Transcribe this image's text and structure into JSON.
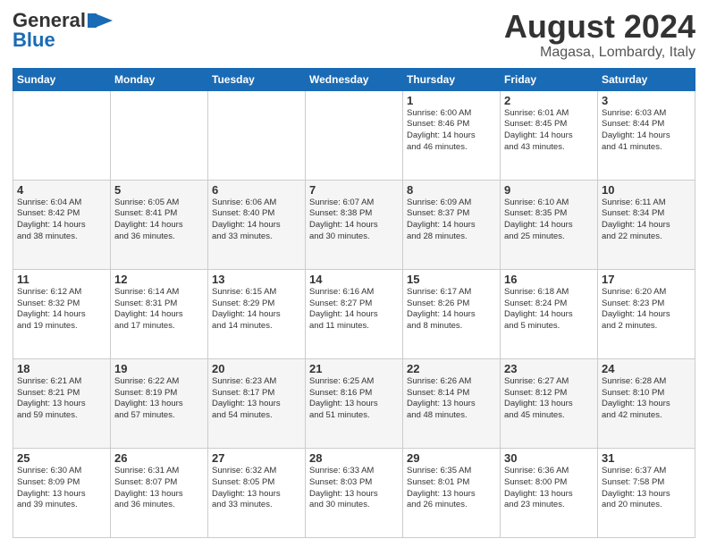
{
  "logo": {
    "line1": "General",
    "line2": "Blue",
    "icon": "▶"
  },
  "header": {
    "month": "August 2024",
    "location": "Magasa, Lombardy, Italy"
  },
  "days_of_week": [
    "Sunday",
    "Monday",
    "Tuesday",
    "Wednesday",
    "Thursday",
    "Friday",
    "Saturday"
  ],
  "weeks": [
    [
      {
        "day": "",
        "text": ""
      },
      {
        "day": "",
        "text": ""
      },
      {
        "day": "",
        "text": ""
      },
      {
        "day": "",
        "text": ""
      },
      {
        "day": "1",
        "text": "Sunrise: 6:00 AM\nSunset: 8:46 PM\nDaylight: 14 hours\nand 46 minutes."
      },
      {
        "day": "2",
        "text": "Sunrise: 6:01 AM\nSunset: 8:45 PM\nDaylight: 14 hours\nand 43 minutes."
      },
      {
        "day": "3",
        "text": "Sunrise: 6:03 AM\nSunset: 8:44 PM\nDaylight: 14 hours\nand 41 minutes."
      }
    ],
    [
      {
        "day": "4",
        "text": "Sunrise: 6:04 AM\nSunset: 8:42 PM\nDaylight: 14 hours\nand 38 minutes."
      },
      {
        "day": "5",
        "text": "Sunrise: 6:05 AM\nSunset: 8:41 PM\nDaylight: 14 hours\nand 36 minutes."
      },
      {
        "day": "6",
        "text": "Sunrise: 6:06 AM\nSunset: 8:40 PM\nDaylight: 14 hours\nand 33 minutes."
      },
      {
        "day": "7",
        "text": "Sunrise: 6:07 AM\nSunset: 8:38 PM\nDaylight: 14 hours\nand 30 minutes."
      },
      {
        "day": "8",
        "text": "Sunrise: 6:09 AM\nSunset: 8:37 PM\nDaylight: 14 hours\nand 28 minutes."
      },
      {
        "day": "9",
        "text": "Sunrise: 6:10 AM\nSunset: 8:35 PM\nDaylight: 14 hours\nand 25 minutes."
      },
      {
        "day": "10",
        "text": "Sunrise: 6:11 AM\nSunset: 8:34 PM\nDaylight: 14 hours\nand 22 minutes."
      }
    ],
    [
      {
        "day": "11",
        "text": "Sunrise: 6:12 AM\nSunset: 8:32 PM\nDaylight: 14 hours\nand 19 minutes."
      },
      {
        "day": "12",
        "text": "Sunrise: 6:14 AM\nSunset: 8:31 PM\nDaylight: 14 hours\nand 17 minutes."
      },
      {
        "day": "13",
        "text": "Sunrise: 6:15 AM\nSunset: 8:29 PM\nDaylight: 14 hours\nand 14 minutes."
      },
      {
        "day": "14",
        "text": "Sunrise: 6:16 AM\nSunset: 8:27 PM\nDaylight: 14 hours\nand 11 minutes."
      },
      {
        "day": "15",
        "text": "Sunrise: 6:17 AM\nSunset: 8:26 PM\nDaylight: 14 hours\nand 8 minutes."
      },
      {
        "day": "16",
        "text": "Sunrise: 6:18 AM\nSunset: 8:24 PM\nDaylight: 14 hours\nand 5 minutes."
      },
      {
        "day": "17",
        "text": "Sunrise: 6:20 AM\nSunset: 8:23 PM\nDaylight: 14 hours\nand 2 minutes."
      }
    ],
    [
      {
        "day": "18",
        "text": "Sunrise: 6:21 AM\nSunset: 8:21 PM\nDaylight: 13 hours\nand 59 minutes."
      },
      {
        "day": "19",
        "text": "Sunrise: 6:22 AM\nSunset: 8:19 PM\nDaylight: 13 hours\nand 57 minutes."
      },
      {
        "day": "20",
        "text": "Sunrise: 6:23 AM\nSunset: 8:17 PM\nDaylight: 13 hours\nand 54 minutes."
      },
      {
        "day": "21",
        "text": "Sunrise: 6:25 AM\nSunset: 8:16 PM\nDaylight: 13 hours\nand 51 minutes."
      },
      {
        "day": "22",
        "text": "Sunrise: 6:26 AM\nSunset: 8:14 PM\nDaylight: 13 hours\nand 48 minutes."
      },
      {
        "day": "23",
        "text": "Sunrise: 6:27 AM\nSunset: 8:12 PM\nDaylight: 13 hours\nand 45 minutes."
      },
      {
        "day": "24",
        "text": "Sunrise: 6:28 AM\nSunset: 8:10 PM\nDaylight: 13 hours\nand 42 minutes."
      }
    ],
    [
      {
        "day": "25",
        "text": "Sunrise: 6:30 AM\nSunset: 8:09 PM\nDaylight: 13 hours\nand 39 minutes."
      },
      {
        "day": "26",
        "text": "Sunrise: 6:31 AM\nSunset: 8:07 PM\nDaylight: 13 hours\nand 36 minutes."
      },
      {
        "day": "27",
        "text": "Sunrise: 6:32 AM\nSunset: 8:05 PM\nDaylight: 13 hours\nand 33 minutes."
      },
      {
        "day": "28",
        "text": "Sunrise: 6:33 AM\nSunset: 8:03 PM\nDaylight: 13 hours\nand 30 minutes."
      },
      {
        "day": "29",
        "text": "Sunrise: 6:35 AM\nSunset: 8:01 PM\nDaylight: 13 hours\nand 26 minutes."
      },
      {
        "day": "30",
        "text": "Sunrise: 6:36 AM\nSunset: 8:00 PM\nDaylight: 13 hours\nand 23 minutes."
      },
      {
        "day": "31",
        "text": "Sunrise: 6:37 AM\nSunset: 7:58 PM\nDaylight: 13 hours\nand 20 minutes."
      }
    ]
  ]
}
